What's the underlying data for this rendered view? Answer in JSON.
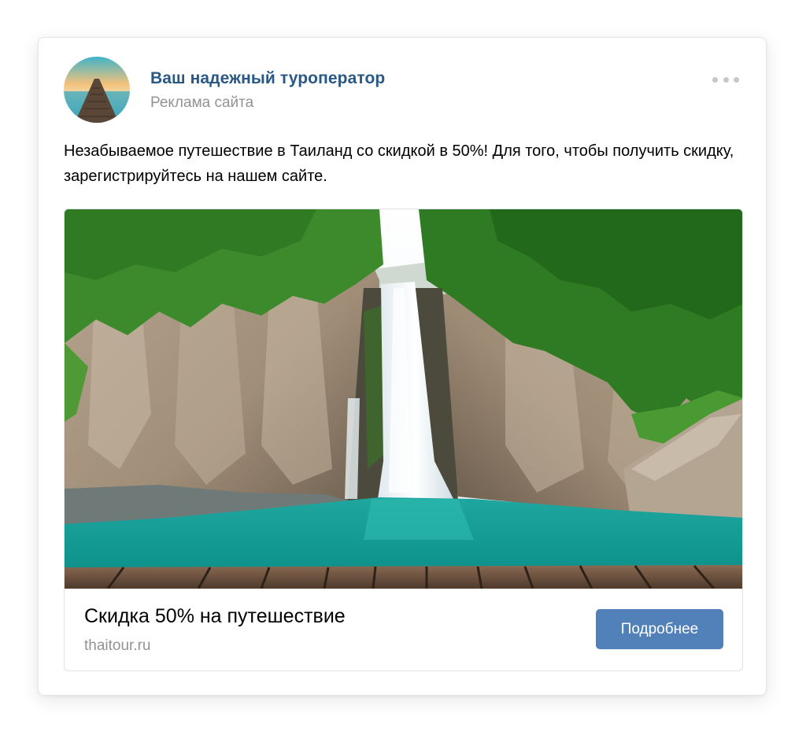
{
  "post": {
    "author": "Ваш надежный туроператор",
    "subtitle": "Реклама сайта",
    "text": "Незабываемое путешествие в Таиланд со скидкой в 50%! Для того, чтобы получить скидку, зарегистрируйтесь на нашем сайте.",
    "more_icon": "more-dots-icon"
  },
  "snippet": {
    "title": "Скидка 50% на путешествие",
    "domain": "thaitour.ru",
    "button_label": "Подробнее"
  },
  "colors": {
    "author_link": "#2a5885",
    "button": "#5181b8",
    "muted_text": "#939393"
  }
}
